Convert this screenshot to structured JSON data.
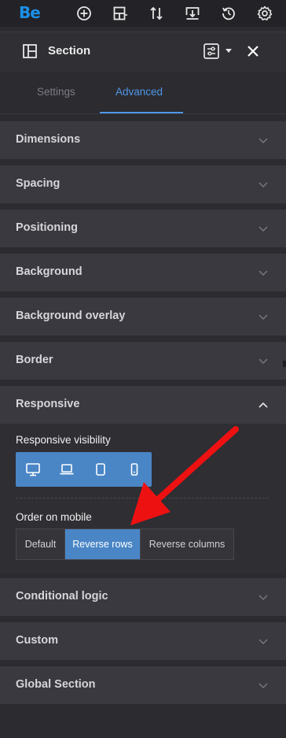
{
  "app": {
    "logo_text": "Be"
  },
  "toolbar": {
    "icons": [
      "add-icon",
      "layout-icon",
      "sort-icon",
      "import-icon",
      "history-icon",
      "settings-icon"
    ]
  },
  "header": {
    "title": "Section"
  },
  "tabs": [
    {
      "label": "Settings",
      "active": false
    },
    {
      "label": "Advanced",
      "active": true
    }
  ],
  "sections": {
    "dimensions": "Dimensions",
    "spacing": "Spacing",
    "positioning": "Positioning",
    "background": "Background",
    "background_overlay": "Background overlay",
    "border": "Border",
    "responsive": "Responsive",
    "conditional_logic": "Conditional logic",
    "custom": "Custom",
    "global_section": "Global Section"
  },
  "responsive": {
    "visibility_label": "Responsive visibility",
    "devices": [
      "desktop-icon",
      "laptop-icon",
      "tablet-icon",
      "mobile-icon"
    ],
    "order_label": "Order on mobile",
    "order_options": [
      "Default",
      "Reverse rows",
      "Reverse columns"
    ],
    "order_selected": "Reverse rows"
  },
  "colors": {
    "accent": "#4f97e8",
    "button_blue": "#4a86c6",
    "logo": "#1a8fe8",
    "annotation_arrow": "#ee1111"
  }
}
